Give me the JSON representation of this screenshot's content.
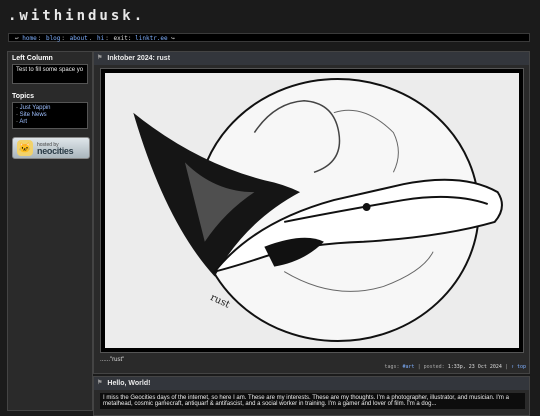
{
  "site": {
    "title": ".withindusk."
  },
  "nav": {
    "prefix": "↩",
    "home": "home",
    "blog": "blog",
    "about": "about",
    "hi": "hi",
    "exit_label": "exit:",
    "linktree": "linktr.ee",
    "suffix": "↪"
  },
  "left_column": {
    "title": "Left Column",
    "text": "Test to fill some space yo"
  },
  "topics": {
    "title": "Topics",
    "items": [
      "Just Yappin",
      "Site News",
      "Art"
    ]
  },
  "badge": {
    "small": "hosted by",
    "big": "neocities"
  },
  "posts": [
    {
      "title": "Inktober 2024: rust",
      "caption": "......\"rust\"",
      "meta": {
        "tags_label": "tags:",
        "tag": "#art",
        "posted_label": "posted:",
        "posted": "1:33p, 23 Oct 2024",
        "top_link": "↑ top"
      }
    },
    {
      "title": "Hello, World!",
      "text": "I miss the Geocities days of the internet, so here I am. These are my interests. These are my thoughts. I'm a photographer, illustrator, and musician. I'm a metalhead, cosmic gamecraft, antiquarf & antifascist, and a social worker in training. I'm a gamer and lover of film. I'm a dog..."
    }
  ],
  "colors": {
    "background": "#1b1b1b",
    "link": "#7fb0ff",
    "panel": "#2a2a2a"
  }
}
